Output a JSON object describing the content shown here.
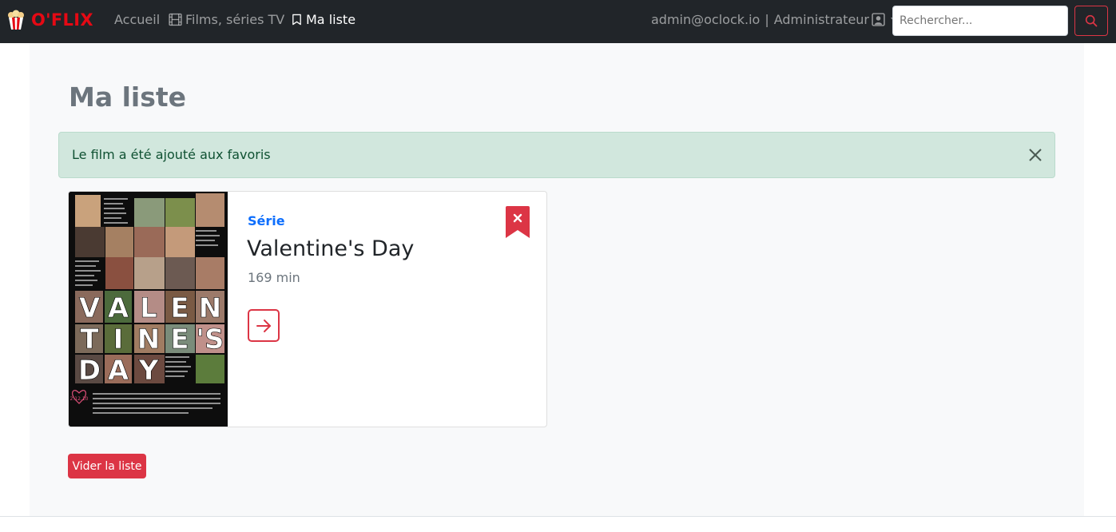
{
  "navbar": {
    "brand": "O'FLIX",
    "links": [
      {
        "label": "Accueil",
        "icon": "none"
      },
      {
        "label": "Films, séries TV",
        "icon": "film-icon"
      },
      {
        "label": "Ma liste",
        "icon": "bookmark-icon"
      }
    ],
    "user_email": "admin@oclock.io",
    "separator": "|",
    "user_role": "Administrateur",
    "search_placeholder": "Rechercher..."
  },
  "main": {
    "title": "Ma liste",
    "alert": "Le film a été ajouté aux favoris",
    "cards": [
      {
        "type": "Série",
        "title": "Valentine's Day",
        "duration": "169 min",
        "poster": {
          "big_letters": [
            "V",
            "A",
            "L",
            "E",
            "N",
            "T",
            "I",
            "N",
            "E",
            "'S",
            "D",
            "A",
            "Y"
          ],
          "date": "2.12.10"
        }
      }
    ],
    "clear_button": "Vider la liste"
  },
  "colors": {
    "navbar_bg": "#212529",
    "brand": "#e50914",
    "danger": "#dc3545",
    "primary": "#0d6efd",
    "alert_bg": "#d1e7dd",
    "alert_text": "#0f5132",
    "page_bg": "#f8f9fa"
  }
}
